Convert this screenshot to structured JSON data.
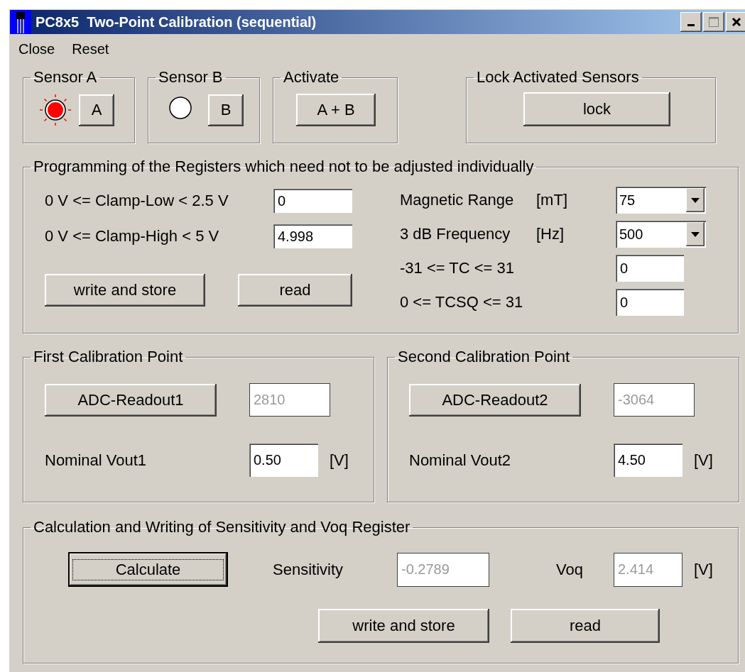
{
  "window": {
    "title": "PC8x5  Two-Point Calibration (sequential)"
  },
  "menu": [
    "Close",
    "Reset"
  ],
  "sensors": [
    {
      "title": "Sensor A",
      "button": "A",
      "on": true
    },
    {
      "title": "Sensor B",
      "button": "B",
      "on": false
    }
  ],
  "activate": {
    "title": "Activate",
    "button": "A + B"
  },
  "lock": {
    "title": "Lock Activated Sensors",
    "button": "lock"
  },
  "registers": {
    "title": "Programming of the Registers which need not to be adjusted individually",
    "left_fields": [
      {
        "label": "0 V <= Clamp-Low < 2.5 V",
        "value": "0"
      },
      {
        "label": "0 V <= Clamp-High < 5 V",
        "value": "4.998"
      }
    ],
    "buttons": [
      "write and store",
      "read"
    ],
    "right_fields": [
      {
        "kind": "dropdown",
        "label": "Magnetic Range",
        "unit": "[mT]",
        "value": "75"
      },
      {
        "kind": "dropdown",
        "label": "3 dB Frequency",
        "unit": "[Hz]",
        "value": "500"
      },
      {
        "kind": "text",
        "label": "-31 <= TC <= 31",
        "value": "0"
      },
      {
        "kind": "text",
        "label": "0 <= TCSQ <= 31",
        "value": "0"
      }
    ]
  },
  "calibration_points": [
    {
      "title": "First Calibration Point",
      "button": "ADC-Readout1",
      "readout": {
        "value": "2810",
        "disabled": true
      },
      "nominal_label": "Nominal Vout1",
      "nominal": {
        "value": "0.50",
        "disabled": false
      },
      "unit": "[V]"
    },
    {
      "title": "Second Calibration Point",
      "button": "ADC-Readout2",
      "readout": {
        "value": "-3064",
        "disabled": true
      },
      "nominal_label": "Nominal Vout2",
      "nominal": {
        "value": "4.50",
        "disabled": false
      },
      "unit": "[V]"
    }
  ],
  "calculation": {
    "title": "Calculation and Writing of Sensitivity and Voq Register",
    "calculate": {
      "label": "Calculate",
      "focused": true
    },
    "outputs": [
      {
        "label": "Sensitivity",
        "value": "-0.2789",
        "disabled": true
      },
      {
        "label": "Voq",
        "value": "2.414",
        "disabled": true,
        "unit": "[V]"
      }
    ],
    "buttons": [
      "write and store",
      "read"
    ]
  }
}
